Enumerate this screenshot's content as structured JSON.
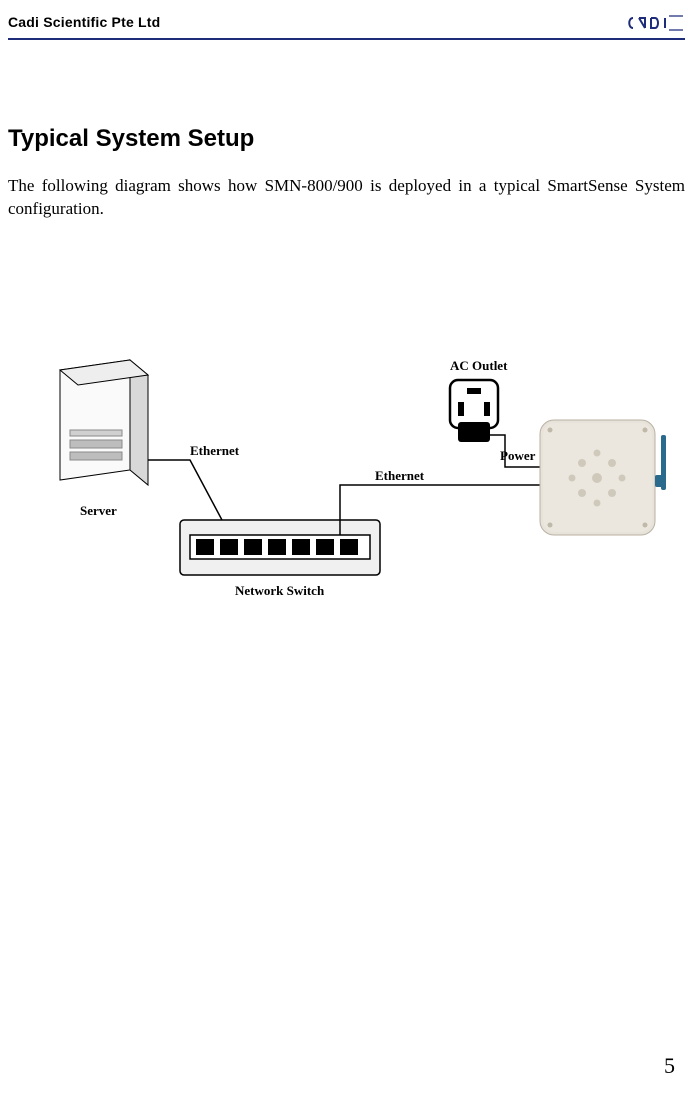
{
  "header": {
    "company": "Cadi Scientific Pte Ltd",
    "logo_name": "cadi-logo"
  },
  "title": "Typical System Setup",
  "intro": "The following diagram shows how SMN-800/900 is deployed in a typical SmartSense System configuration.",
  "diagram": {
    "labels": {
      "server": "Server",
      "ethernet1": "Ethernet",
      "ethernet2": "Ethernet",
      "network_switch": "Network Switch",
      "ac_outlet": "AC Outlet",
      "power": "Power"
    }
  },
  "page_number": "5"
}
